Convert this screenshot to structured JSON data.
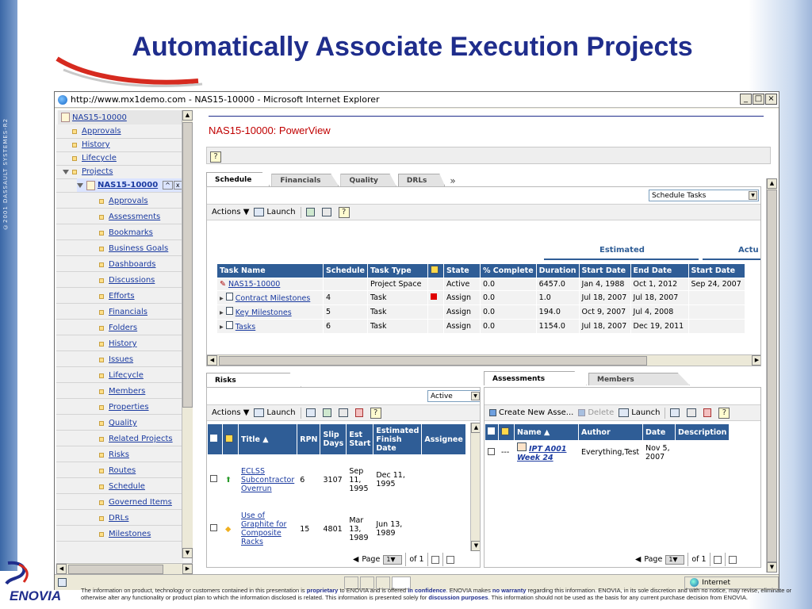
{
  "slide": {
    "title": "Automatically Associate Execution Projects",
    "side_text": "©2001 DASSAULT SYSTEMES-R2",
    "logo_text": "ENOVIA",
    "footer_parts": [
      "The information on product, technology or customers contained in this presentation is ",
      "proprietary",
      " to ENOVIA and is offered ",
      "in confidence",
      ". ENOVIA makes ",
      "no warranty",
      " regarding this information. ENOVIA, in its sole discretion and with no notice, may revise, eliminate or otherwise alter any functionality or product plan to which the information disclosed is related. This information is presented solely for ",
      "discussion purposes",
      ". This information should not be used as the basis for any current purchase decision from ENOVIA."
    ]
  },
  "window": {
    "title": "http://www.mx1demo.com - NAS15-10000 - Microsoft Internet Explorer",
    "status_zone": "Internet"
  },
  "nav": {
    "root": "NAS15-10000",
    "top_items": [
      "Approvals",
      "History",
      "Lifecycle",
      "Projects"
    ],
    "selected": "NAS15-10000",
    "sub_items": [
      "Approvals",
      "Assessments",
      "Bookmarks",
      "Business Goals",
      "Dashboards",
      "Discussions",
      "Efforts",
      "Financials",
      "Folders",
      "History",
      "Issues",
      "Lifecycle",
      "Members",
      "Properties",
      "Quality",
      "Related Projects",
      "Risks",
      "Routes",
      "Schedule",
      "Governed Items",
      "DRLs",
      "Milestones"
    ]
  },
  "main": {
    "page_title": "NAS15-10000: PowerView",
    "help_icon": "?",
    "tabs": [
      "Schedule",
      "Financials",
      "Quality",
      "DRLs"
    ],
    "tabs_more": "»",
    "schedule_select": "Schedule Tasks",
    "toolbar": {
      "actions": "Actions",
      "launch": "Launch"
    },
    "group_estimated": "Estimated",
    "group_actual": "Actu",
    "columns": [
      "Task Name",
      "Schedule",
      "Task Type",
      "",
      "State",
      "% Complete",
      "Duration",
      "Start Date",
      "End Date",
      "Start Date"
    ],
    "rows": [
      {
        "name": "NAS15-10000",
        "schedule": "",
        "type": "Project Space",
        "flag": "",
        "state": "Active",
        "complete": "0.0",
        "duration": "6457.0",
        "start": "Jan 4, 1988",
        "end": "Oct 1, 2012",
        "actual_start": "Sep 24, 2007"
      },
      {
        "name": "Contract Milestones",
        "schedule": "4",
        "type": "Task",
        "flag": "red",
        "state": "Assign",
        "complete": "0.0",
        "duration": "1.0",
        "start": "Jul 18, 2007",
        "end": "Jul 18, 2007",
        "actual_start": ""
      },
      {
        "name": "Key Milestones",
        "schedule": "5",
        "type": "Task",
        "flag": "",
        "state": "Assign",
        "complete": "0.0",
        "duration": "194.0",
        "start": "Oct 9, 2007",
        "end": "Jul 4, 2008",
        "actual_start": ""
      },
      {
        "name": "Tasks",
        "schedule": "6",
        "type": "Task",
        "flag": "",
        "state": "Assign",
        "complete": "0.0",
        "duration": "1154.0",
        "start": "Jul 18, 2007",
        "end": "Dec 19, 2011",
        "actual_start": ""
      }
    ]
  },
  "risks": {
    "tab": "Risks",
    "select": "Active",
    "toolbar": {
      "actions": "Actions",
      "launch": "Launch"
    },
    "columns": [
      "Title",
      "RPN",
      "Slip Days",
      "Est Start",
      "Estimated Finish Date",
      "Assignee"
    ],
    "rows": [
      {
        "title": "ECLSS Subcontractor Overrun",
        "rpn": "6",
        "slip": "3107",
        "est_start": "Sep 11, 1995",
        "finish": "Dec 11, 1995",
        "assignee": ""
      },
      {
        "title": "Use of Graphite for Composite Racks",
        "rpn": "15",
        "slip": "4801",
        "est_start": "Mar 13, 1989",
        "finish": "Jun 13, 1989",
        "assignee": ""
      }
    ],
    "pager": {
      "page_label": "Page",
      "page_value": "1",
      "of_label": "of 1"
    }
  },
  "assessments": {
    "tabs": [
      "Assessments",
      "Members"
    ],
    "toolbar": {
      "create": "Create New Asse...",
      "delete": "Delete",
      "launch": "Launch"
    },
    "columns": [
      "Name",
      "Author",
      "Date",
      "Description"
    ],
    "rows": [
      {
        "marker": "---",
        "name": "IPT A001 Week 24",
        "author": "Everything,Test",
        "date": "Nov 5, 2007",
        "description": ""
      }
    ],
    "pager": {
      "page_label": "Page",
      "page_value": "1",
      "of_label": "of 1"
    }
  },
  "colors": {
    "title_blue": "#1f2d8c",
    "header_blue": "#2f5d96",
    "powerview_red": "#c00000"
  }
}
